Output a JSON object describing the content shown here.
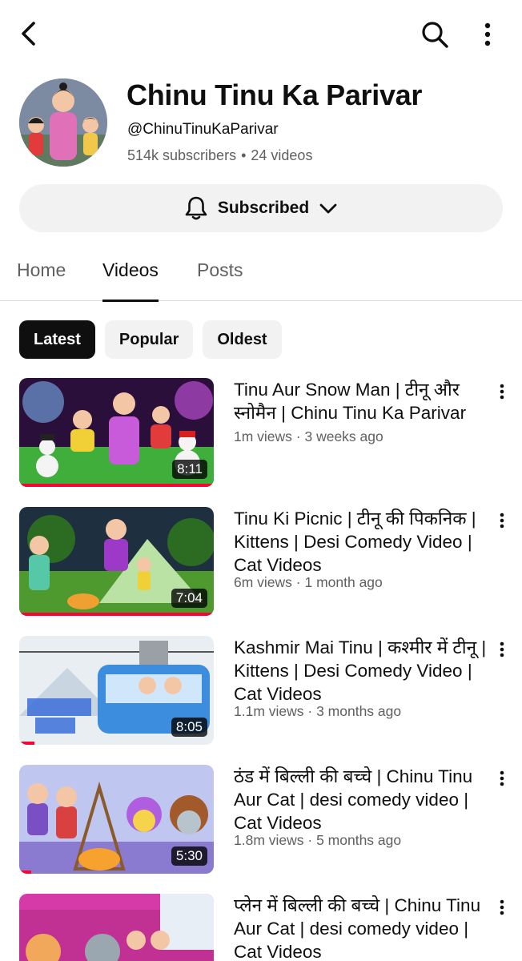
{
  "header": {
    "back_icon": "chevron-left-icon",
    "search_icon": "search-icon",
    "more_icon": "vertical-dots-icon"
  },
  "channel": {
    "name": "Chinu Tinu Ka Parivar",
    "handle": "@ChinuTinuKaParivar",
    "subscribers": "514k subscribers",
    "videos_count": "24 videos",
    "separator": "•"
  },
  "subscribe": {
    "label": "Subscribed",
    "bell_icon": "bell-icon",
    "chevron_icon": "chevron-down-icon"
  },
  "tabs": [
    {
      "label": "Home",
      "active": false
    },
    {
      "label": "Videos",
      "active": true
    },
    {
      "label": "Posts",
      "active": false
    }
  ],
  "filters": [
    {
      "label": "Latest",
      "selected": true
    },
    {
      "label": "Popular",
      "selected": false
    },
    {
      "label": "Oldest",
      "selected": false
    }
  ],
  "videos": [
    {
      "title": "Tinu Aur Snow Man | टीनू और स्नोमैन  | Chinu Tinu Ka Parivar",
      "meta": "1m views · 3 weeks ago",
      "duration": "8:11",
      "watched": 1.0
    },
    {
      "title": "Tinu Ki Picnic | टीनू की पिकनिक  | Kittens | Desi Comedy Video | Cat Videos",
      "meta": "6m views · 1 month ago",
      "duration": "7:04",
      "watched": 1.0
    },
    {
      "title": "Kashmir Mai Tinu | कश्मीर में टीनू  | Kittens | Desi Comedy Video | Cat Videos",
      "meta": "1.1m views · 3 months ago",
      "duration": "8:05",
      "watched": 0.08
    },
    {
      "title": "ठंड में बिल्ली की बच्चे | Chinu Tinu Aur Cat | desi comedy video | Cat Videos",
      "meta": "1.8m views · 5 months ago",
      "duration": "5:30",
      "watched": 0.06
    },
    {
      "title": "प्लेन में बिल्ली की बच्चे  | Chinu Tinu Aur Cat | desi comedy video | Cat Videos",
      "meta": "",
      "duration": "",
      "watched": 0
    }
  ],
  "colors": {
    "progress": "#ff0033",
    "chip_selected_bg": "#0f0f0f",
    "chip_bg": "#f2f2f2",
    "secondary_text": "#606060"
  }
}
